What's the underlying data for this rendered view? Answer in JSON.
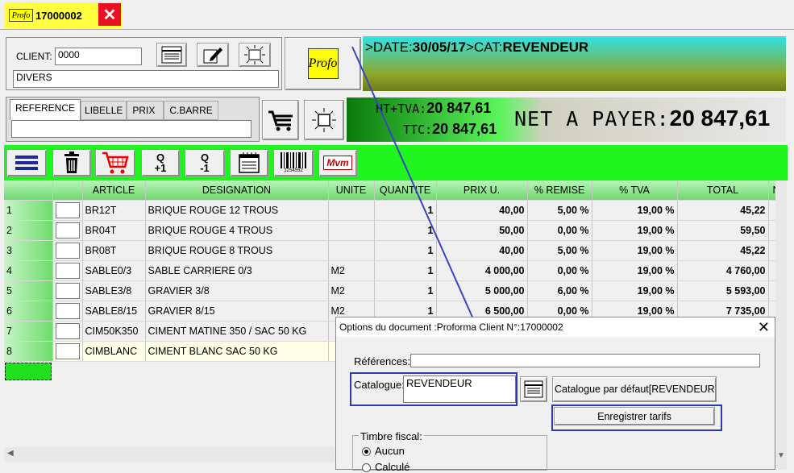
{
  "tab": {
    "logo": "Profo",
    "doc_number": "17000002"
  },
  "client": {
    "label": "CLIENT:",
    "code": "0000",
    "name": "DIVERS"
  },
  "profo_logo": "Profo",
  "header_info": {
    "date_prefix": ">DATE:",
    "date": "30/05/17",
    "cat_prefix": ">CAT:",
    "cat": "REVENDEUR"
  },
  "search_tabs": [
    "REFERENCE",
    "LIBELLE",
    "PRIX",
    "C.BARRE"
  ],
  "totals": {
    "ht_tva_label": "HT+TVA:",
    "ht_tva": "20 847,61",
    "ttc_label": "TTC:",
    "ttc": "20 847,61",
    "net_label": "NET A PAYER:",
    "net": "20 847,61"
  },
  "toolbar": {
    "qplus_top": "Q",
    "qplus_bottom": "+1",
    "qminus_top": "Q",
    "qminus_bottom": "-1",
    "barcode": "1254552",
    "mvm": "Mvm"
  },
  "columns": [
    "ARTICLE",
    "DESIGNATION",
    "UNITE",
    "QUANTITE",
    "PRIX U.",
    "% REMISE",
    "% TVA",
    "TOTAL",
    "N"
  ],
  "rows": [
    [
      "1",
      "BR12T",
      "BRIQUE ROUGE 12 TROUS",
      "",
      "1",
      "40,00",
      "5,00 %",
      "19,00 %",
      "45,22"
    ],
    [
      "2",
      "BR04T",
      "BRIQUE ROUGE 4 TROUS",
      "",
      "1",
      "50,00",
      "0,00 %",
      "19,00 %",
      "59,50"
    ],
    [
      "3",
      "BR08T",
      "BRIQUE ROUGE 8 TROUS",
      "",
      "1",
      "40,00",
      "5,00 %",
      "19,00 %",
      "45,22"
    ],
    [
      "4",
      "SABLE0/3",
      "SABLE CARRIERE 0/3",
      "M2",
      "1",
      "4 000,00",
      "0,00 %",
      "19,00 %",
      "4 760,00"
    ],
    [
      "5",
      "SABLE3/8",
      "GRAVIER 3/8",
      "M2",
      "1",
      "5 000,00",
      "6,00 %",
      "19,00 %",
      "5 593,00"
    ],
    [
      "6",
      "SABLE8/15",
      "GRAVIER 8/15",
      "M2",
      "1",
      "6 500,00",
      "0,00 %",
      "19,00 %",
      "7 735,00"
    ],
    [
      "7",
      "CIM50K350",
      "CIMENT MATINE 350  / SAC 50 KG",
      "",
      "",
      "",
      "",
      "",
      ""
    ],
    [
      "8",
      "CIMBLANC",
      "CIMENT BLANC SAC 50 KG",
      "",
      "",
      "",
      "",
      "",
      ""
    ]
  ],
  "dialog": {
    "title": "Options du document :Proforma Client N°:17000002",
    "references_label": "Références:",
    "references_value": "",
    "catalogue_label": "Catalogue:",
    "catalogue_value": "REVENDEUR",
    "default_catalogue_button": "Catalogue par défaut[REVENDEUR",
    "save_prices_button": "Enregistrer tarifs",
    "timbre_label": "Timbre fiscal:",
    "radio_none": "Aucun",
    "radio_calc": "Calculé"
  }
}
